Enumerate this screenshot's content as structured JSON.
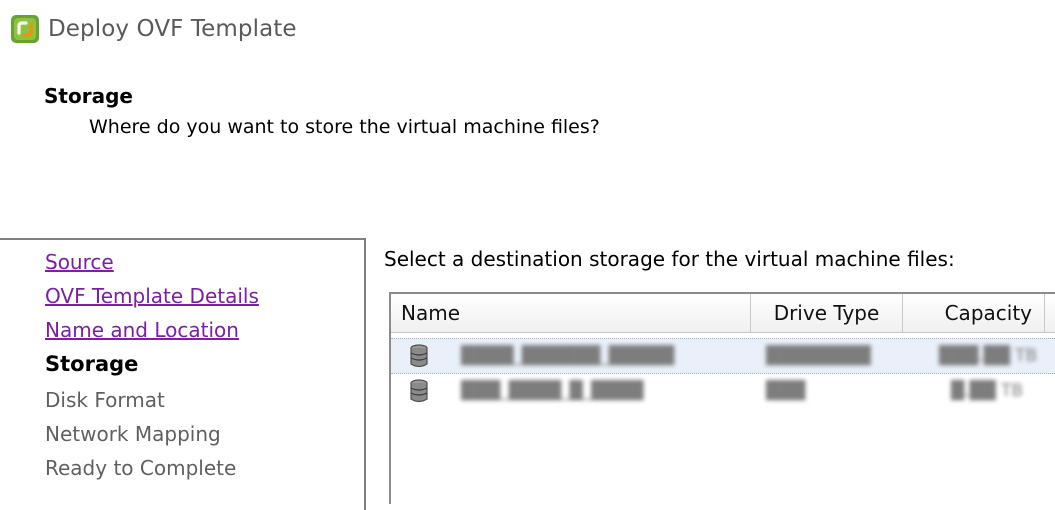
{
  "window": {
    "title": "Deploy OVF Template",
    "icon": "vsphere-logo-icon"
  },
  "header": {
    "step": "Storage",
    "question": "Where do you want to store the virtual machine files?"
  },
  "nav": {
    "items": [
      {
        "label": "Source",
        "state": "visited"
      },
      {
        "label": "OVF Template Details",
        "state": "visited"
      },
      {
        "label": "Name and Location",
        "state": "visited"
      },
      {
        "label": "Storage",
        "state": "current"
      },
      {
        "label": "Disk Format",
        "state": "pending"
      },
      {
        "label": "Network Mapping",
        "state": "pending"
      },
      {
        "label": "Ready to Complete",
        "state": "pending"
      }
    ]
  },
  "main": {
    "prompt": "Select a destination storage for the virtual machine files:",
    "table": {
      "columns": [
        "Name",
        "Drive Type",
        "Capacity"
      ],
      "rows": [
        {
          "icon": "datastore-icon",
          "name": "████_██████_█████",
          "drive_type": "████████",
          "capacity": "███.██ TB",
          "selected": true
        },
        {
          "icon": "datastore-icon",
          "name": "███_████_█_████",
          "drive_type": "███",
          "capacity": "█.██ TB",
          "selected": false
        }
      ]
    }
  },
  "colors": {
    "visited_link": "#7a1fa6",
    "selection": "#e9f0f9"
  }
}
